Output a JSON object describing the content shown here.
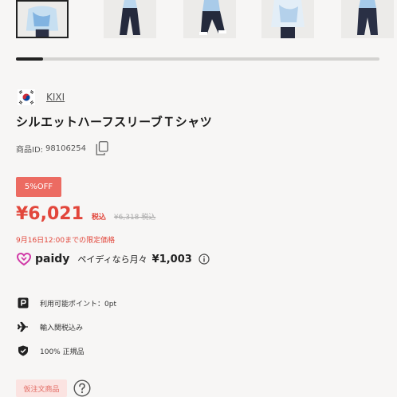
{
  "gallery": {
    "thumbnails": [
      {
        "icon": "product-photo-1",
        "selected": true
      },
      {
        "icon": "product-photo-2",
        "selected": false
      },
      {
        "icon": "product-photo-3",
        "selected": false
      },
      {
        "icon": "product-photo-4",
        "selected": false
      },
      {
        "icon": "product-photo-5",
        "selected": false
      }
    ],
    "scroll_position": 0.07
  },
  "brand": {
    "flag_icon": "korea-flag-icon",
    "name": "KIXI"
  },
  "product": {
    "title": "シルエットハーフスリーブＴシャツ",
    "id_label": "商品ID:",
    "id_value": "98106254"
  },
  "pricing": {
    "discount_badge": "5%OFF",
    "price": "¥6,021",
    "tax_label": "税込",
    "original_price": "¥6,318 税込",
    "deadline": "9月16日12:00までの限定価格"
  },
  "paidy": {
    "brand": "paidy",
    "text": "ペイディなら月々",
    "amount": "¥1,003"
  },
  "features": [
    {
      "icon": "points-icon",
      "label": "利用可能ポイント：0pt"
    },
    {
      "icon": "airplane-icon",
      "label": "輸入関税込み"
    },
    {
      "icon": "shield-check-icon",
      "label": "100% 正規品"
    }
  ],
  "tag": {
    "label": "仮注文商品"
  },
  "colors": {
    "accent_red": "#e2463b",
    "badge_red": "#ec6b62",
    "paidy_purple": "#d13aa7"
  }
}
